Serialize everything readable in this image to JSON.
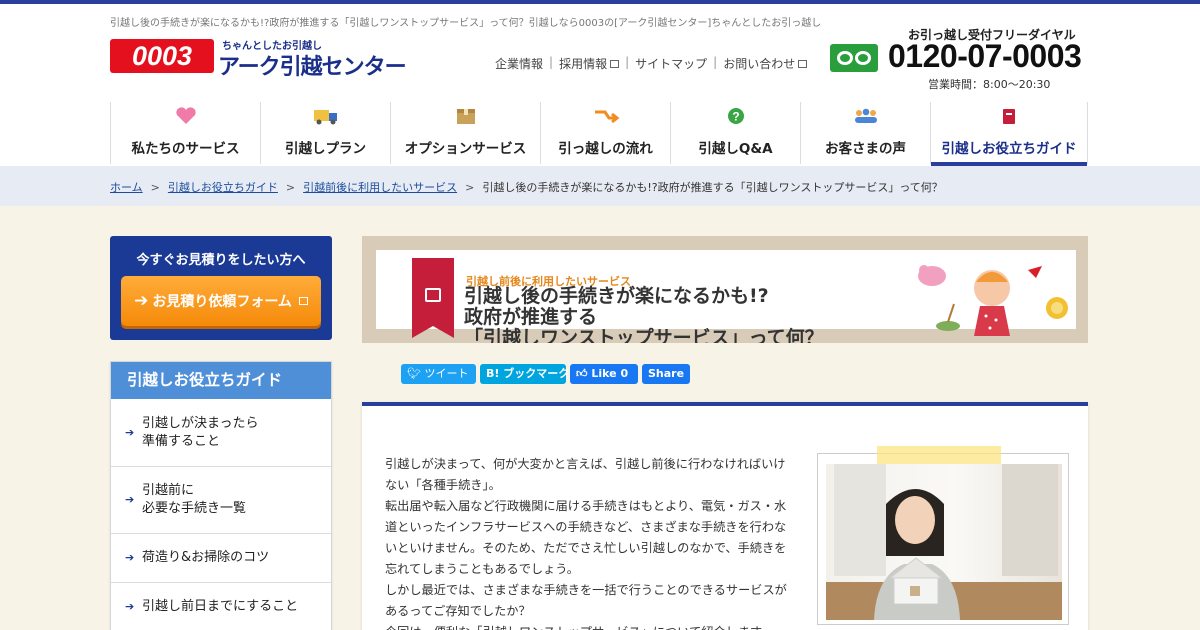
{
  "header": {
    "tagline": "引越し後の手続きが楽になるかも!?政府が推進する「引越しワンストップサービス」って何？引越しなら0003の[アーク引越センター]ちゃんとしたお引っ越し",
    "logo_num": "0003",
    "logo_sub": "ちゃんとしたお引越し",
    "logo_name": "アーク引越センター",
    "utility_links": [
      "企業情報",
      "採用情報",
      "サイトマップ",
      "お問い合わせ"
    ],
    "freedial_label": "お引っ越し受付フリーダイヤル",
    "phone": "0120-07-0003",
    "hours": "営業時間：8:00〜20:30"
  },
  "nav": {
    "items": [
      {
        "label": "私たちのサービス",
        "icon": "heart-icon"
      },
      {
        "label": "引越しプラン",
        "icon": "truck-icon"
      },
      {
        "label": "オプションサービス",
        "icon": "box-icon"
      },
      {
        "label": "引っ越しの流れ",
        "icon": "flow-arrow-icon"
      },
      {
        "label": "引越しQ&A",
        "icon": "question-icon"
      },
      {
        "label": "お客さまの声",
        "icon": "people-icon"
      },
      {
        "label": "引越しお役立ちガイド",
        "icon": "book-icon"
      }
    ]
  },
  "breadcrumb": {
    "items": [
      "ホーム",
      "引越しお役立ちガイド",
      "引越前後に利用したいサービス"
    ],
    "current": "引越し後の手続きが楽になるかも!?政府が推進する「引越しワンストップサービス」って何？"
  },
  "sidebar": {
    "estimate_title": "今すぐお見積りをしたい方へ",
    "estimate_button": "お見積り依頼フォーム",
    "guide_title": "引越しお役立ちガイド",
    "guide_items": [
      {
        "line1": "引越しが決まったら",
        "line2": "準備すること"
      },
      {
        "line1": "引越前に",
        "line2": "必要な手続き一覧"
      },
      {
        "line1": "荷造り&お掃除のコツ",
        "line2": ""
      },
      {
        "line1": "引越し前日までにすること",
        "line2": ""
      }
    ]
  },
  "hero": {
    "category": "引越し前後に利用したいサービス",
    "title_line1": "引越し後の手続きが楽になるかも!?",
    "title_line2": "政府が推進する",
    "title_line3": "「引越しワンストップサービス」って何？"
  },
  "social": {
    "tweet": "ツイート",
    "hatena": "ブックマーク",
    "like": "Like",
    "like_count": "0",
    "share": "Share"
  },
  "article": {
    "paragraphs": [
      "引越しが決まって、何が大変かと言えば、引越し前後に行わなければいけない「各種手続き」。",
      "転出届や転入届など行政機関に届ける手続きはもとより、電気・ガス・水道といったインフラサービスへの手続きなど、さまざまな手続きを行わないといけません。そのため、ただでさえ忙しい引越しのなかで、手続きを忘れてしまうこともあるでしょう。",
      "しかし最近では、さまざまな手続きを一括で行うことのできるサービスがあるってご存知でしたか？",
      "今回は、便利な「引越しワンストップサービス」について紹介します。"
    ]
  },
  "colors": {
    "brand_blue": "#2a3e9c",
    "brand_red": "#e5101e",
    "accent_orange": "#f58a0a",
    "freedial_green": "#2a9e3c"
  }
}
